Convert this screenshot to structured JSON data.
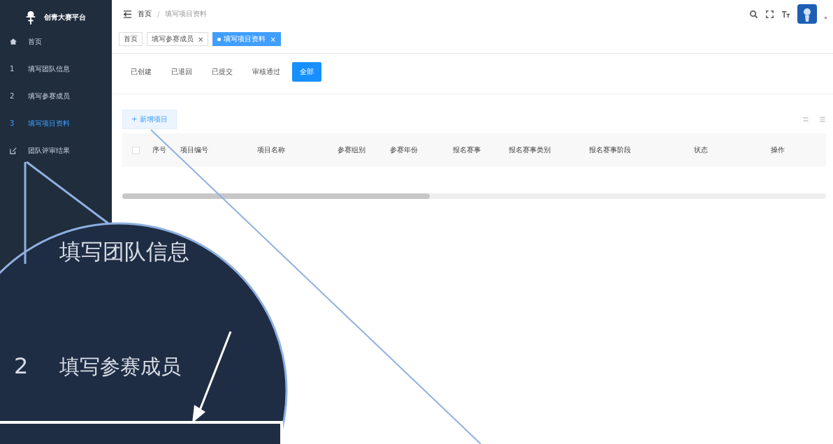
{
  "sidebar": {
    "title": "创青大赛平台",
    "items": [
      {
        "kind": "home",
        "label": "首页",
        "selected": false
      },
      {
        "kind": "step",
        "number": "1",
        "label": "填写团队信息",
        "selected": false
      },
      {
        "kind": "step",
        "number": "2",
        "label": "填写参赛成员",
        "selected": false
      },
      {
        "kind": "step",
        "number": "3",
        "label": "填写项目资料",
        "selected": true
      },
      {
        "kind": "edit",
        "label": "团队评审结果",
        "selected": false
      }
    ]
  },
  "breadcrumb": {
    "separator": "/",
    "items": [
      "首页",
      "填写项目资料"
    ]
  },
  "tags": [
    {
      "label": "首页",
      "closable": false,
      "selected": false
    },
    {
      "label": "填写参赛成员",
      "closable": true,
      "selected": false
    },
    {
      "label": "填写项目资料",
      "closable": true,
      "selected": true
    }
  ],
  "close_mark": "×",
  "tabs": [
    {
      "label": "已创建",
      "selected": false
    },
    {
      "label": "已退回",
      "selected": false
    },
    {
      "label": "已提交",
      "selected": false
    },
    {
      "label": "审核通过",
      "selected": false
    },
    {
      "label": "全部",
      "selected": true
    }
  ],
  "add_button": "+ 新增项目",
  "table": {
    "select_all": {
      "checked": false
    },
    "columns": [
      "序号",
      "项目编号",
      "项目名称",
      "参赛组别",
      "参赛年份",
      "报名赛事",
      "报名赛事类别",
      "报名赛事阶段",
      "状态",
      "操作"
    ]
  },
  "magnifier": {
    "items": [
      {
        "label": "填写团队信息"
      },
      {
        "number": "2",
        "label": "填写参赛成员"
      }
    ]
  }
}
